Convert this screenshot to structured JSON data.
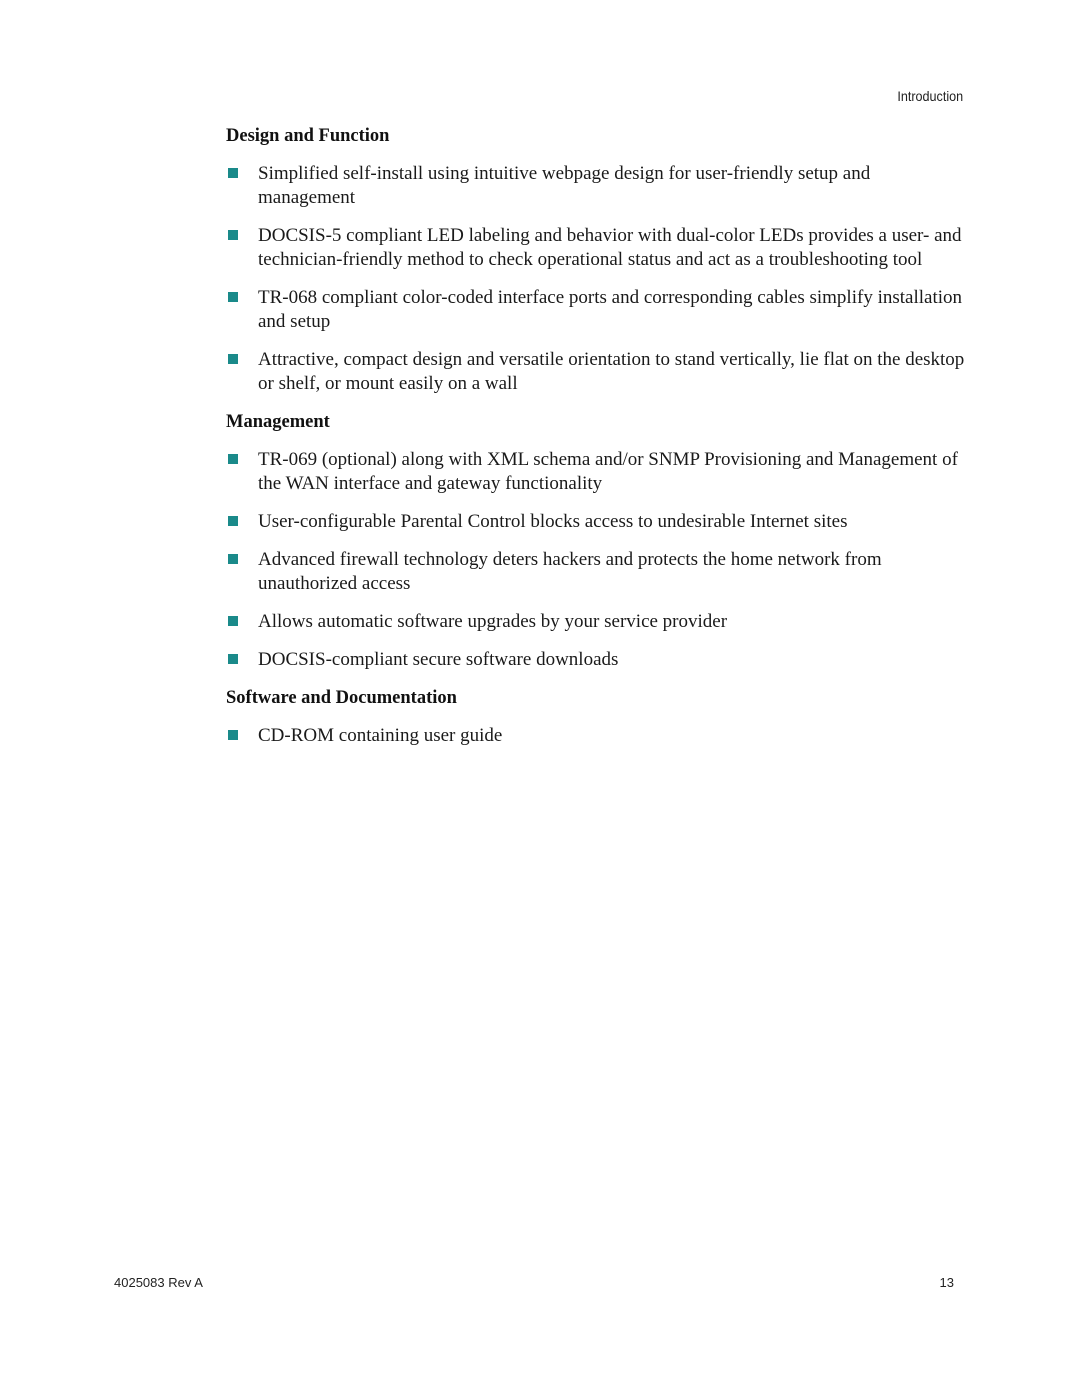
{
  "header": {
    "running_title": "Introduction"
  },
  "bullet_color": "#1a8a8a",
  "sections": [
    {
      "heading": "Design and Function",
      "items": [
        "Simplified self-install using intuitive webpage design for user-friendly setup and management",
        "DOCSIS-5 compliant LED labeling and behavior with dual-color LEDs provides a user- and technician-friendly method to check operational status and act as a troubleshooting tool",
        "TR-068 compliant color-coded interface ports and corresponding cables simplify installation and setup",
        "Attractive, compact design and versatile orientation to stand vertically, lie flat on the desktop or shelf, or mount easily on a wall"
      ]
    },
    {
      "heading": "Management",
      "items": [
        "TR-069 (optional) along with XML schema and/or SNMP Provisioning and Management of the WAN interface and gateway functionality",
        "User-configurable Parental Control blocks access to undesirable Internet sites",
        "Advanced firewall technology deters hackers and protects the home network from unauthorized access",
        "Allows automatic software upgrades by your service provider",
        "DOCSIS-compliant secure software downloads"
      ]
    },
    {
      "heading": "Software and Documentation",
      "items": [
        "CD-ROM containing user guide"
      ]
    }
  ],
  "footer": {
    "document_number": "4025083 Rev A",
    "page_number": "13"
  }
}
